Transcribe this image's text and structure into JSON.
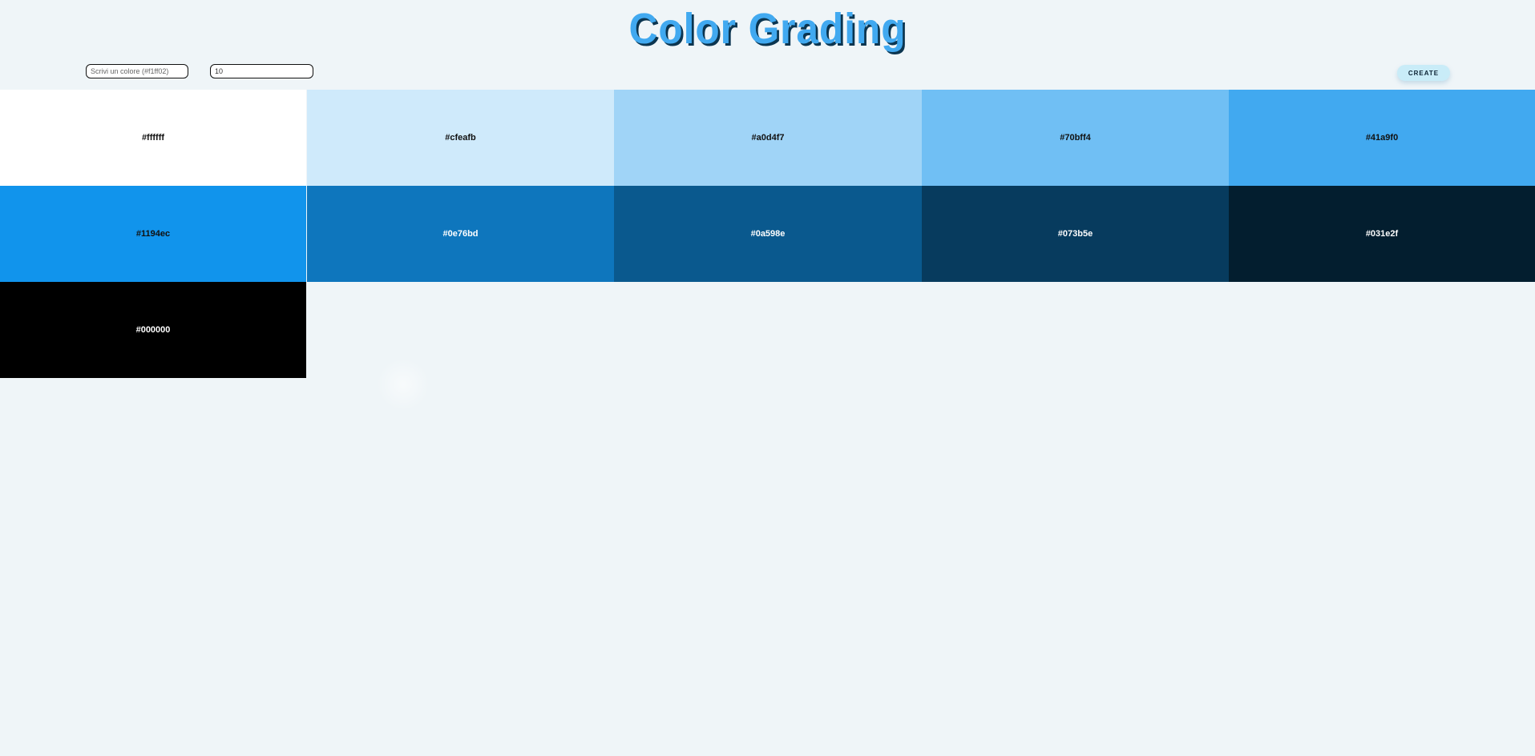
{
  "header": {
    "title": "Color Grading"
  },
  "controls": {
    "color_placeholder": "Scrivi un colore (#f1ff02)",
    "color_value": "",
    "count_value": "10",
    "create_label": "CREATE"
  },
  "swatches": [
    {
      "hex": "#ffffff",
      "text_color": "#111111"
    },
    {
      "hex": "#cfeafb",
      "text_color": "#111111"
    },
    {
      "hex": "#a0d4f7",
      "text_color": "#111111"
    },
    {
      "hex": "#70bff4",
      "text_color": "#111111"
    },
    {
      "hex": "#41a9f0",
      "text_color": "#111111"
    },
    {
      "hex": "#1194ec",
      "text_color": "#111111"
    },
    {
      "hex": "#0e76bd",
      "text_color": "#ffffff"
    },
    {
      "hex": "#0a598e",
      "text_color": "#ffffff"
    },
    {
      "hex": "#073b5e",
      "text_color": "#ffffff"
    },
    {
      "hex": "#031e2f",
      "text_color": "#ffffff"
    },
    {
      "hex": "#000000",
      "text_color": "#ffffff"
    }
  ],
  "colors": {
    "title": "#41a9f0",
    "title_shadow": "#0b3550",
    "background": "#eff5f8",
    "button": "#c9ecf8"
  }
}
